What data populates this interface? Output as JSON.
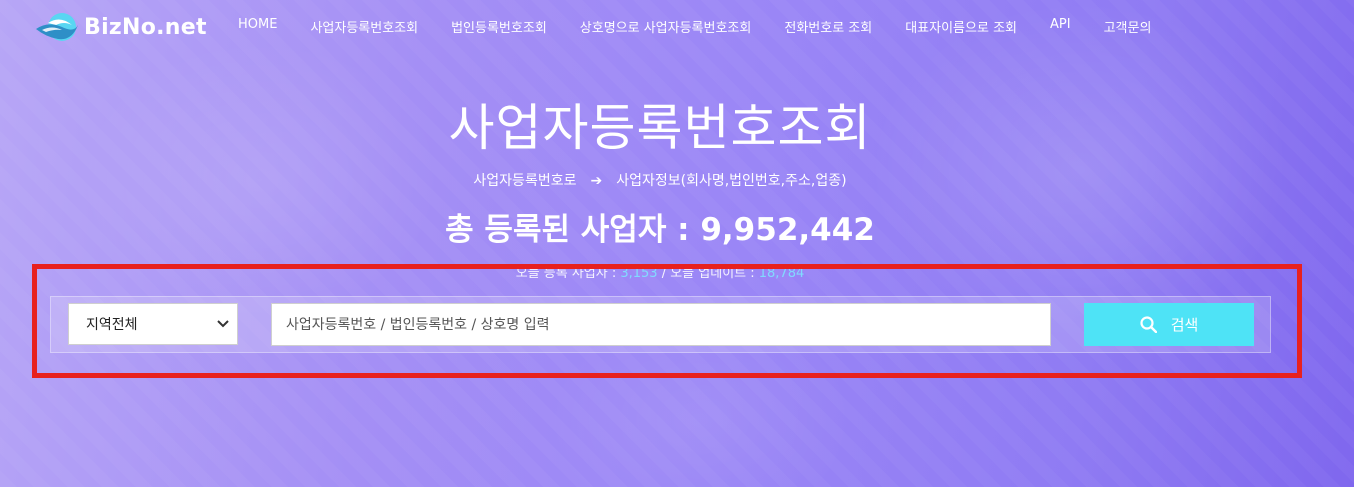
{
  "colors": {
    "accent": "#4ee3f6",
    "highlight_border": "#e8211e",
    "background_start": "#b7a6f6",
    "background_end": "#7f67ee"
  },
  "nav": {
    "logo_text": "BizNo.net",
    "items": [
      {
        "label": "HOME"
      },
      {
        "label": "사업자등록번호조회"
      },
      {
        "label": "법인등록번호조회"
      },
      {
        "label": "상호명으로 사업자등록번호조회"
      },
      {
        "label": "전화번호로 조회"
      },
      {
        "label": "대표자이름으로 조회"
      },
      {
        "label": "API"
      },
      {
        "label": "고객문의"
      }
    ]
  },
  "hero": {
    "title": "사업자등록번호조회",
    "subtitle_from": "사업자등록번호로",
    "subtitle_arrow": "➔",
    "subtitle_to": "사업자정보(회사명,법인번호,주소,업종)",
    "total_label": "총 등록된 사업자 : 9,952,442"
  },
  "today": {
    "new_label": "오늘 등록 사업자 : ",
    "new_count": "3,153",
    "update_label": " / 오늘 업데이트 : ",
    "update_count": "18,784"
  },
  "search": {
    "region_selected": "지역전체",
    "region_icon": "chevron-down-icon",
    "placeholder": "사업자등록번호 / 법인등록번호 / 상호명 입력",
    "value": "",
    "button_label": "검색",
    "button_icon": "search-icon"
  }
}
